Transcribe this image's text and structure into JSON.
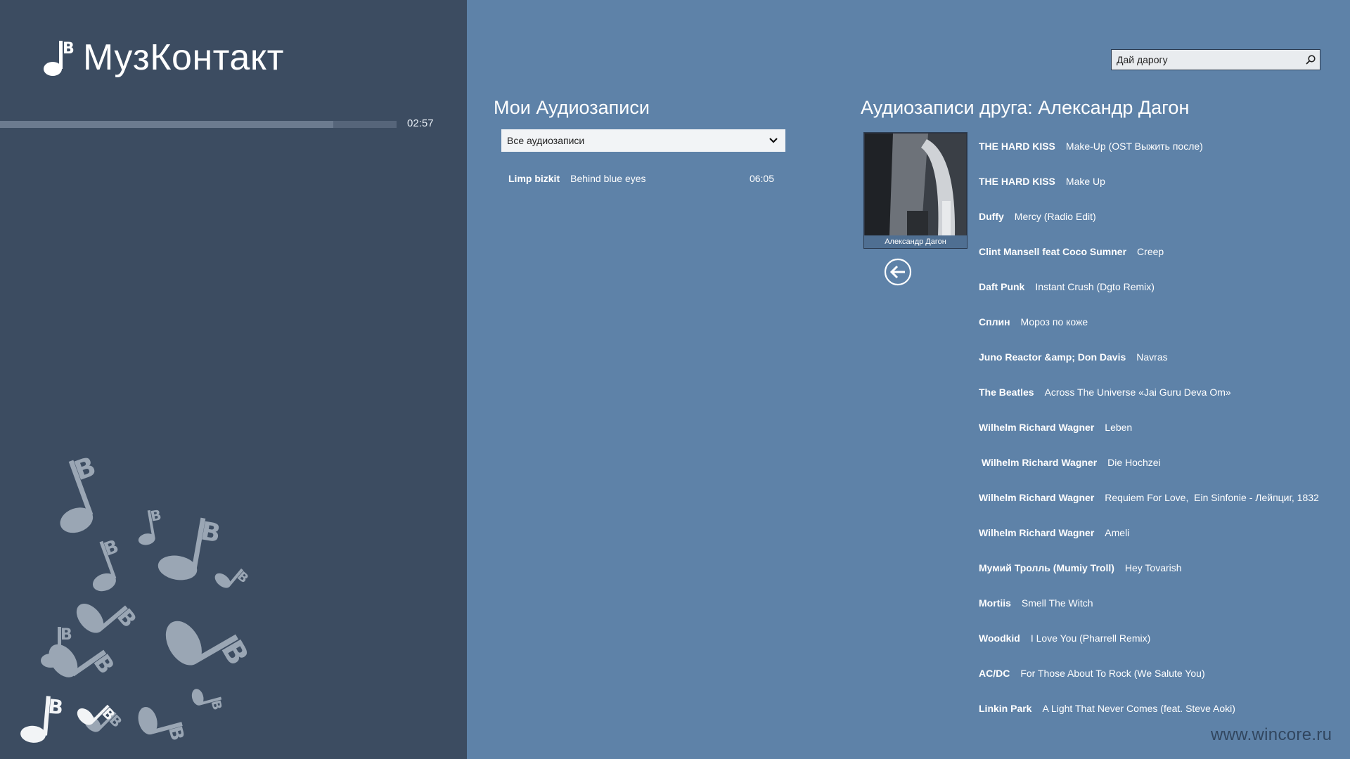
{
  "app": {
    "title": "МузКонтакт"
  },
  "player": {
    "time": "02:57",
    "progress": 0.84
  },
  "search": {
    "value": "Дай дарогу",
    "icon": "search-icon"
  },
  "my_audio": {
    "title": "Мои Аудиозаписи",
    "filter_selected": "Все аудиозаписи",
    "tracks": [
      {
        "artist": "Limp bizkit",
        "title": "Behind blue eyes",
        "duration": "06:05"
      }
    ]
  },
  "friend": {
    "title": "Аудиозаписи друга: Александр Дагон",
    "name": "Александр Дагон",
    "tracks": [
      {
        "artist": "THE HARD KISS",
        "title": "Make-Up (OST Выжить после)"
      },
      {
        "artist": "THE HARD KISS",
        "title": "Make Up"
      },
      {
        "artist": "Duffy",
        "title": "Mercy (Radio Edit)"
      },
      {
        "artist": "Clint Mansell feat Coco Sumner",
        "title": "Creep"
      },
      {
        "artist": "Daft Punk",
        "title": "Instant Crush (Dgto Remix)"
      },
      {
        "artist": "Сплин",
        "title": "Мороз по коже"
      },
      {
        "artist": "Juno Reactor &amp; Don Davis",
        "title": "Navras"
      },
      {
        "artist": "The Beatles",
        "title": "Across The Universe «Jai Guru Deva Om»"
      },
      {
        "artist": "Wilhelm Richard Wagner",
        "title": "Leben"
      },
      {
        "artist": " Wilhelm Richard Wagner",
        "title": "Die Hochzei"
      },
      {
        "artist": "Wilhelm Richard Wagner",
        "title": "Requiem For Love,  Ein Sinfonie - Лейпциг, 1832"
      },
      {
        "artist": "Wilhelm Richard Wagner",
        "title": "Ameli"
      },
      {
        "artist": "Мумий Тролль (Mumiy Troll)",
        "title": "Hey Tovarish"
      },
      {
        "artist": "Mortiis",
        "title": "Smell The Witch"
      },
      {
        "artist": "Woodkid",
        "title": "I Love You (Pharrell Remix)"
      },
      {
        "artist": "AC/DC",
        "title": "For Those About To Rock (We Salute You)"
      },
      {
        "artist": "Linkin Park",
        "title": "A Light That Never Comes (feat. Steve Aoki)"
      }
    ]
  },
  "watermark": "www.wincore.ru",
  "colors": {
    "sidebar": "#3c4c61",
    "main": "#5e82a8",
    "progress_fill": "#6c7b8f",
    "notes": "#9aa6b4"
  }
}
